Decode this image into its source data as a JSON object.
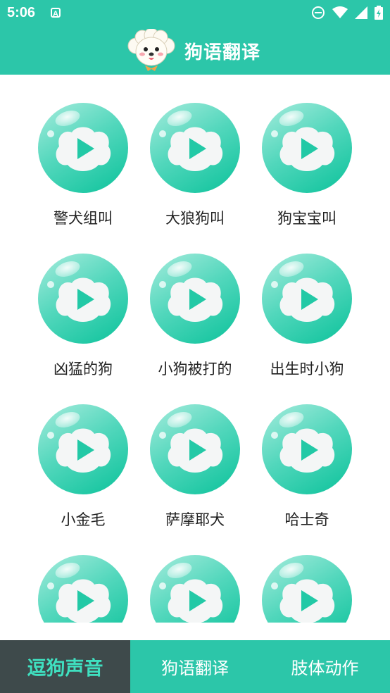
{
  "status_bar": {
    "time": "5:06",
    "notification_icon": "A",
    "icons": [
      "do-not-disturb-icon",
      "wifi-icon",
      "signal-icon",
      "battery-charging-icon"
    ]
  },
  "header": {
    "title": "狗语翻译",
    "logo_icon": "dog-face-icon"
  },
  "colors": {
    "primary": "#2cc6a9",
    "nav_active_bg": "#3e4a4b",
    "nav_active_text": "#3fe0c0",
    "bubble_light": "#8de6d4",
    "bubble_dark": "#22c9a6"
  },
  "sounds": [
    {
      "label": "警犬组叫"
    },
    {
      "label": "大狼狗叫"
    },
    {
      "label": "狗宝宝叫"
    },
    {
      "label": "凶猛的狗"
    },
    {
      "label": "小狗被打的"
    },
    {
      "label": "出生时小狗"
    },
    {
      "label": "小金毛"
    },
    {
      "label": "萨摩耶犬"
    },
    {
      "label": "哈士奇"
    },
    {
      "label": ""
    },
    {
      "label": ""
    },
    {
      "label": ""
    }
  ],
  "bottom_nav": {
    "items": [
      {
        "label": "逗狗声音",
        "active": true
      },
      {
        "label": "狗语翻译",
        "active": false
      },
      {
        "label": "肢体动作",
        "active": false
      }
    ]
  }
}
